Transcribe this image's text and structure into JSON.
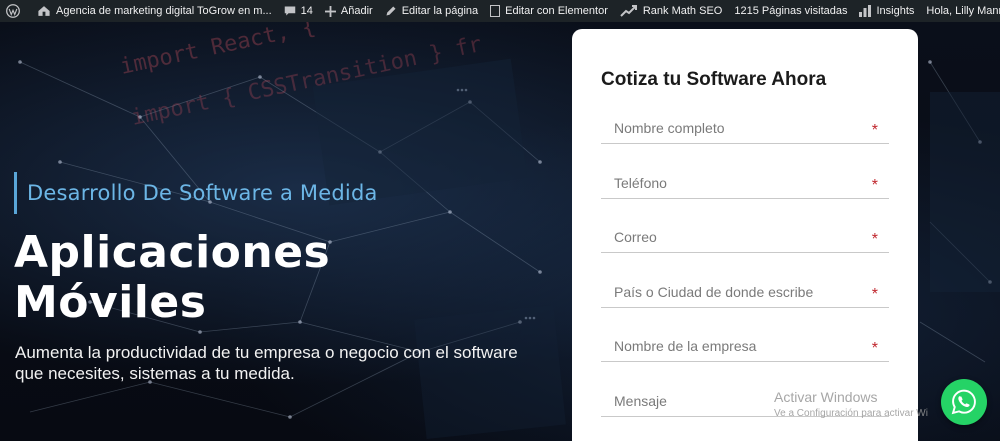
{
  "adminbar": {
    "site_name": "Agencia de marketing digital ToGrow en m...",
    "comments_count": "14",
    "add_new": "Añadir",
    "edit_page": "Editar la página",
    "edit_elementor": "Editar con Elementor",
    "rank_math": "Rank Math SEO",
    "page_visits": "1215 Páginas visitadas",
    "insights": "Insights",
    "greeting": "Hola, Lilly Manrique"
  },
  "hero": {
    "tagline": "Desarrollo De Software a Medida",
    "headline_line1": "Aplicaciones",
    "headline_line2": "Móviles",
    "description": "Aumenta la productividad de tu empresa o negocio con el software que necesites, sistemas a tu medida.",
    "bg_code_1": "import React, {",
    "bg_code_2": "import { CSSTransition } fr"
  },
  "form": {
    "title": "Cotiza tu Software Ahora",
    "fields": [
      {
        "placeholder": "Nombre completo",
        "required": "*"
      },
      {
        "placeholder": "Teléfono",
        "required": "*"
      },
      {
        "placeholder": "Correo",
        "required": "*"
      },
      {
        "placeholder": "País o Ciudad de donde escribe",
        "required": "*"
      },
      {
        "placeholder": "Nombre de la empresa",
        "required": "*"
      },
      {
        "placeholder": "Mensaje"
      }
    ]
  },
  "watermark": {
    "line1": "Activar Windows",
    "line2": "Ve a Configuración para activar Wi"
  },
  "colors": {
    "adminbar_bg": "#1d2327",
    "tagline": "#6cb6e6",
    "required": "#c0262d",
    "whatsapp": "#25d366"
  },
  "icons": {
    "wp": "wordpress-icon",
    "site": "home-icon",
    "comments": "comment-icon",
    "add": "plus-icon",
    "edit": "pencil-icon",
    "elementor": "elementor-icon",
    "rankmath": "chart-icon",
    "insights": "bar-chart-icon",
    "whatsapp": "whatsapp-icon"
  }
}
